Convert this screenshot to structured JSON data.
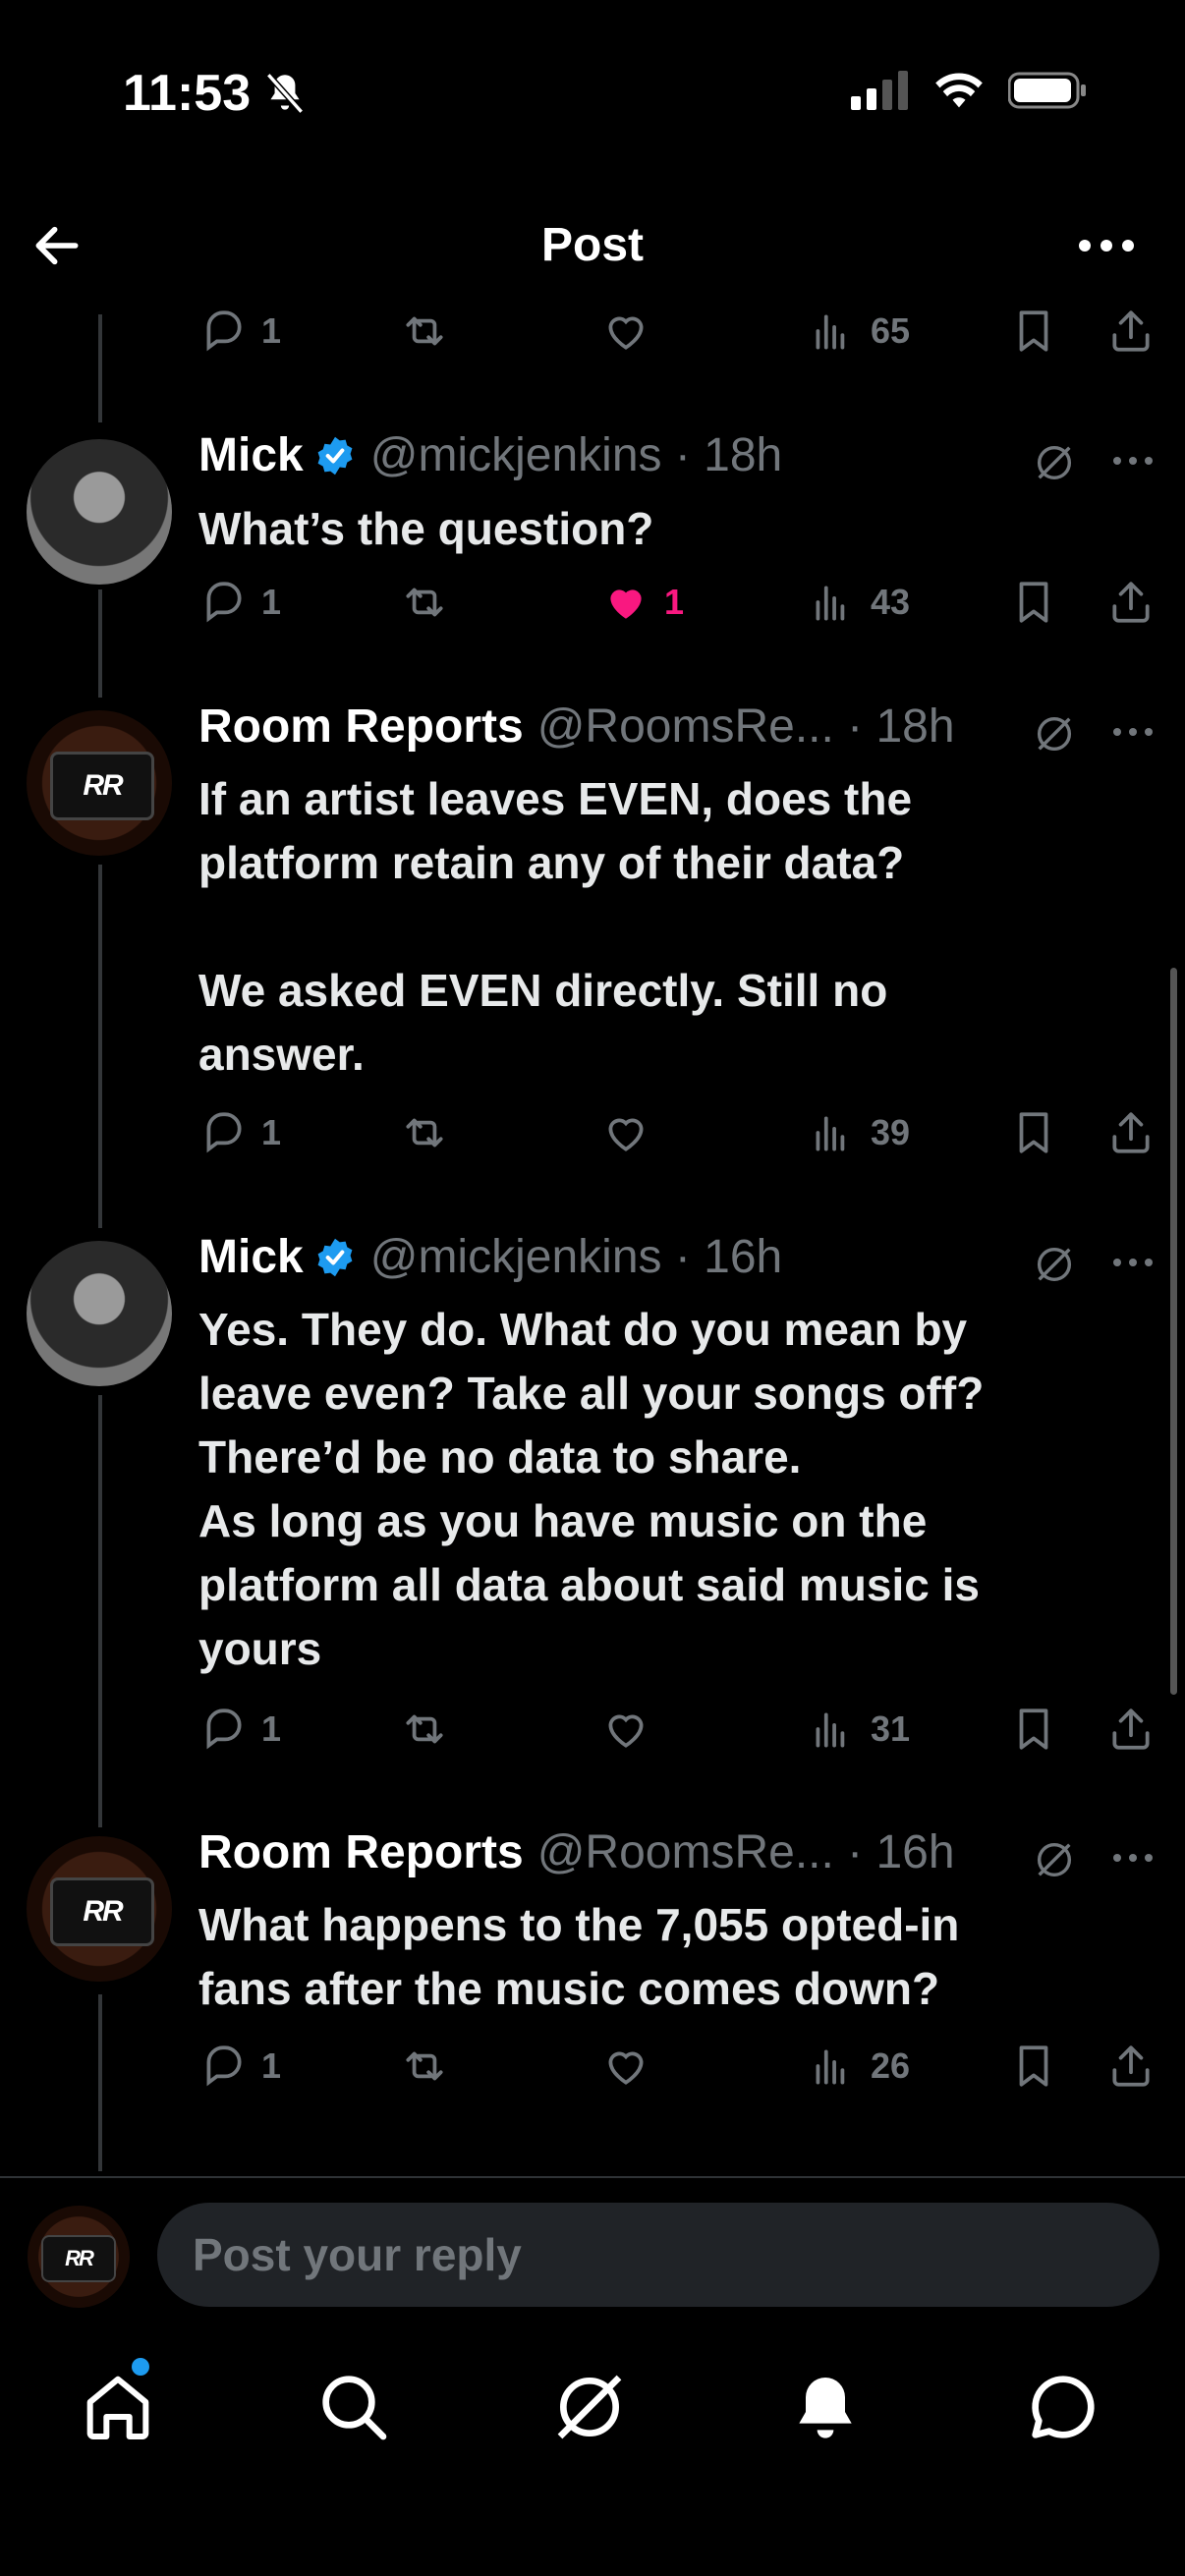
{
  "status_bar": {
    "time": "11:53"
  },
  "header": {
    "title": "Post"
  },
  "top_actions": {
    "replies": "1",
    "views": "65"
  },
  "posts": [
    {
      "name": "Mick",
      "handle": "@mickjenkins · 18h",
      "body": "What’s the question?",
      "replies": "1",
      "likes": "1",
      "views": "43",
      "liked": true
    },
    {
      "name": "Room Reports",
      "handle": "@RoomsRe... · 18h",
      "body": "If an artist leaves EVEN, does the\nplatform retain any of their data?\n\nWe asked EVEN directly. Still no\nanswer.",
      "replies": "1",
      "likes": "",
      "views": "39",
      "liked": false
    },
    {
      "name": "Mick",
      "handle": "@mickjenkins · 16h",
      "body": "Yes. They do. What do you mean by\nleave even? Take all your songs off?\nThere’d be no data to share.\nAs long as you have music on the\nplatform all data about said music is\nyours",
      "replies": "1",
      "likes": "",
      "views": "31",
      "liked": false
    },
    {
      "name": "Room Reports",
      "handle": "@RoomsRe... · 16h",
      "body": "What happens to the 7,055 opted-in\nfans after the music comes down?",
      "replies": "1",
      "likes": "",
      "views": "26",
      "liked": false
    }
  ],
  "avatar_text": "RR",
  "reply_bar": {
    "placeholder": "Post your reply"
  },
  "colors": {
    "accent": "#1d9bf0",
    "like": "#f91880",
    "muted": "#71767b",
    "background": "#000000"
  },
  "icons": [
    "back-arrow-icon",
    "more-icon",
    "reply-icon",
    "retweet-icon",
    "heart-icon",
    "views-icon",
    "bookmark-icon",
    "share-icon",
    "grok-icon",
    "verified-icon",
    "home-icon",
    "search-icon",
    "grok-tab-icon",
    "bell-icon",
    "chat-icon"
  ]
}
